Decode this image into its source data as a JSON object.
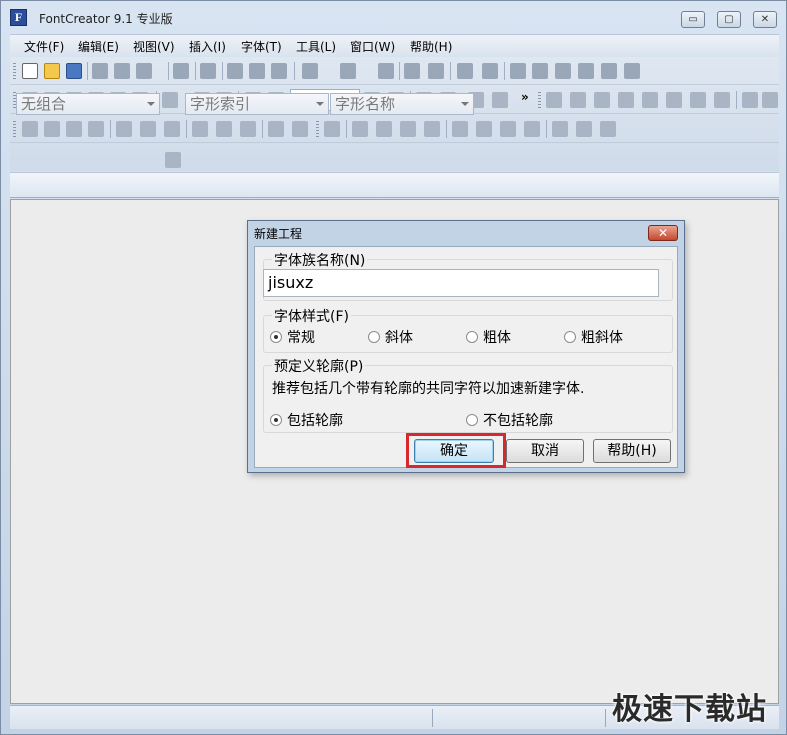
{
  "window": {
    "title": "FontCreator 9.1 专业版",
    "icon_letter": "F",
    "minimize": "▭",
    "maximize": "▢",
    "close": "✕"
  },
  "menu": [
    "文件(F)",
    "编辑(E)",
    "视图(V)",
    "插入(I)",
    "字体(T)",
    "工具(L)",
    "窗口(W)",
    "帮助(H)"
  ],
  "toolbar": {
    "zoom_value": "",
    "more_glyph": "»"
  },
  "combos": {
    "group": "无组合",
    "glyph_index": "字形索引",
    "glyph_name": "字形名称"
  },
  "dialog": {
    "title": "新建工程",
    "close": "✕",
    "family_label": "字体族名称(N)",
    "family_value": "jisuxz",
    "style_label": "字体样式(F)",
    "styles": [
      "常规",
      "斜体",
      "粗体",
      "粗斜体"
    ],
    "selected_style": "常规",
    "outline_label": "预定义轮廓(P)",
    "outline_desc": "推荐包括几个带有轮廓的共同字符以加速新建字体.",
    "outline_options": [
      "包括轮廓",
      "不包括轮廓"
    ],
    "selected_outline": "包括轮廓",
    "ok": "确定",
    "cancel": "取消",
    "help": "帮助(H)"
  },
  "watermark": "极速下载站",
  "colors": {
    "highlight": "#d9272e",
    "frame": "#c3d3e6"
  }
}
